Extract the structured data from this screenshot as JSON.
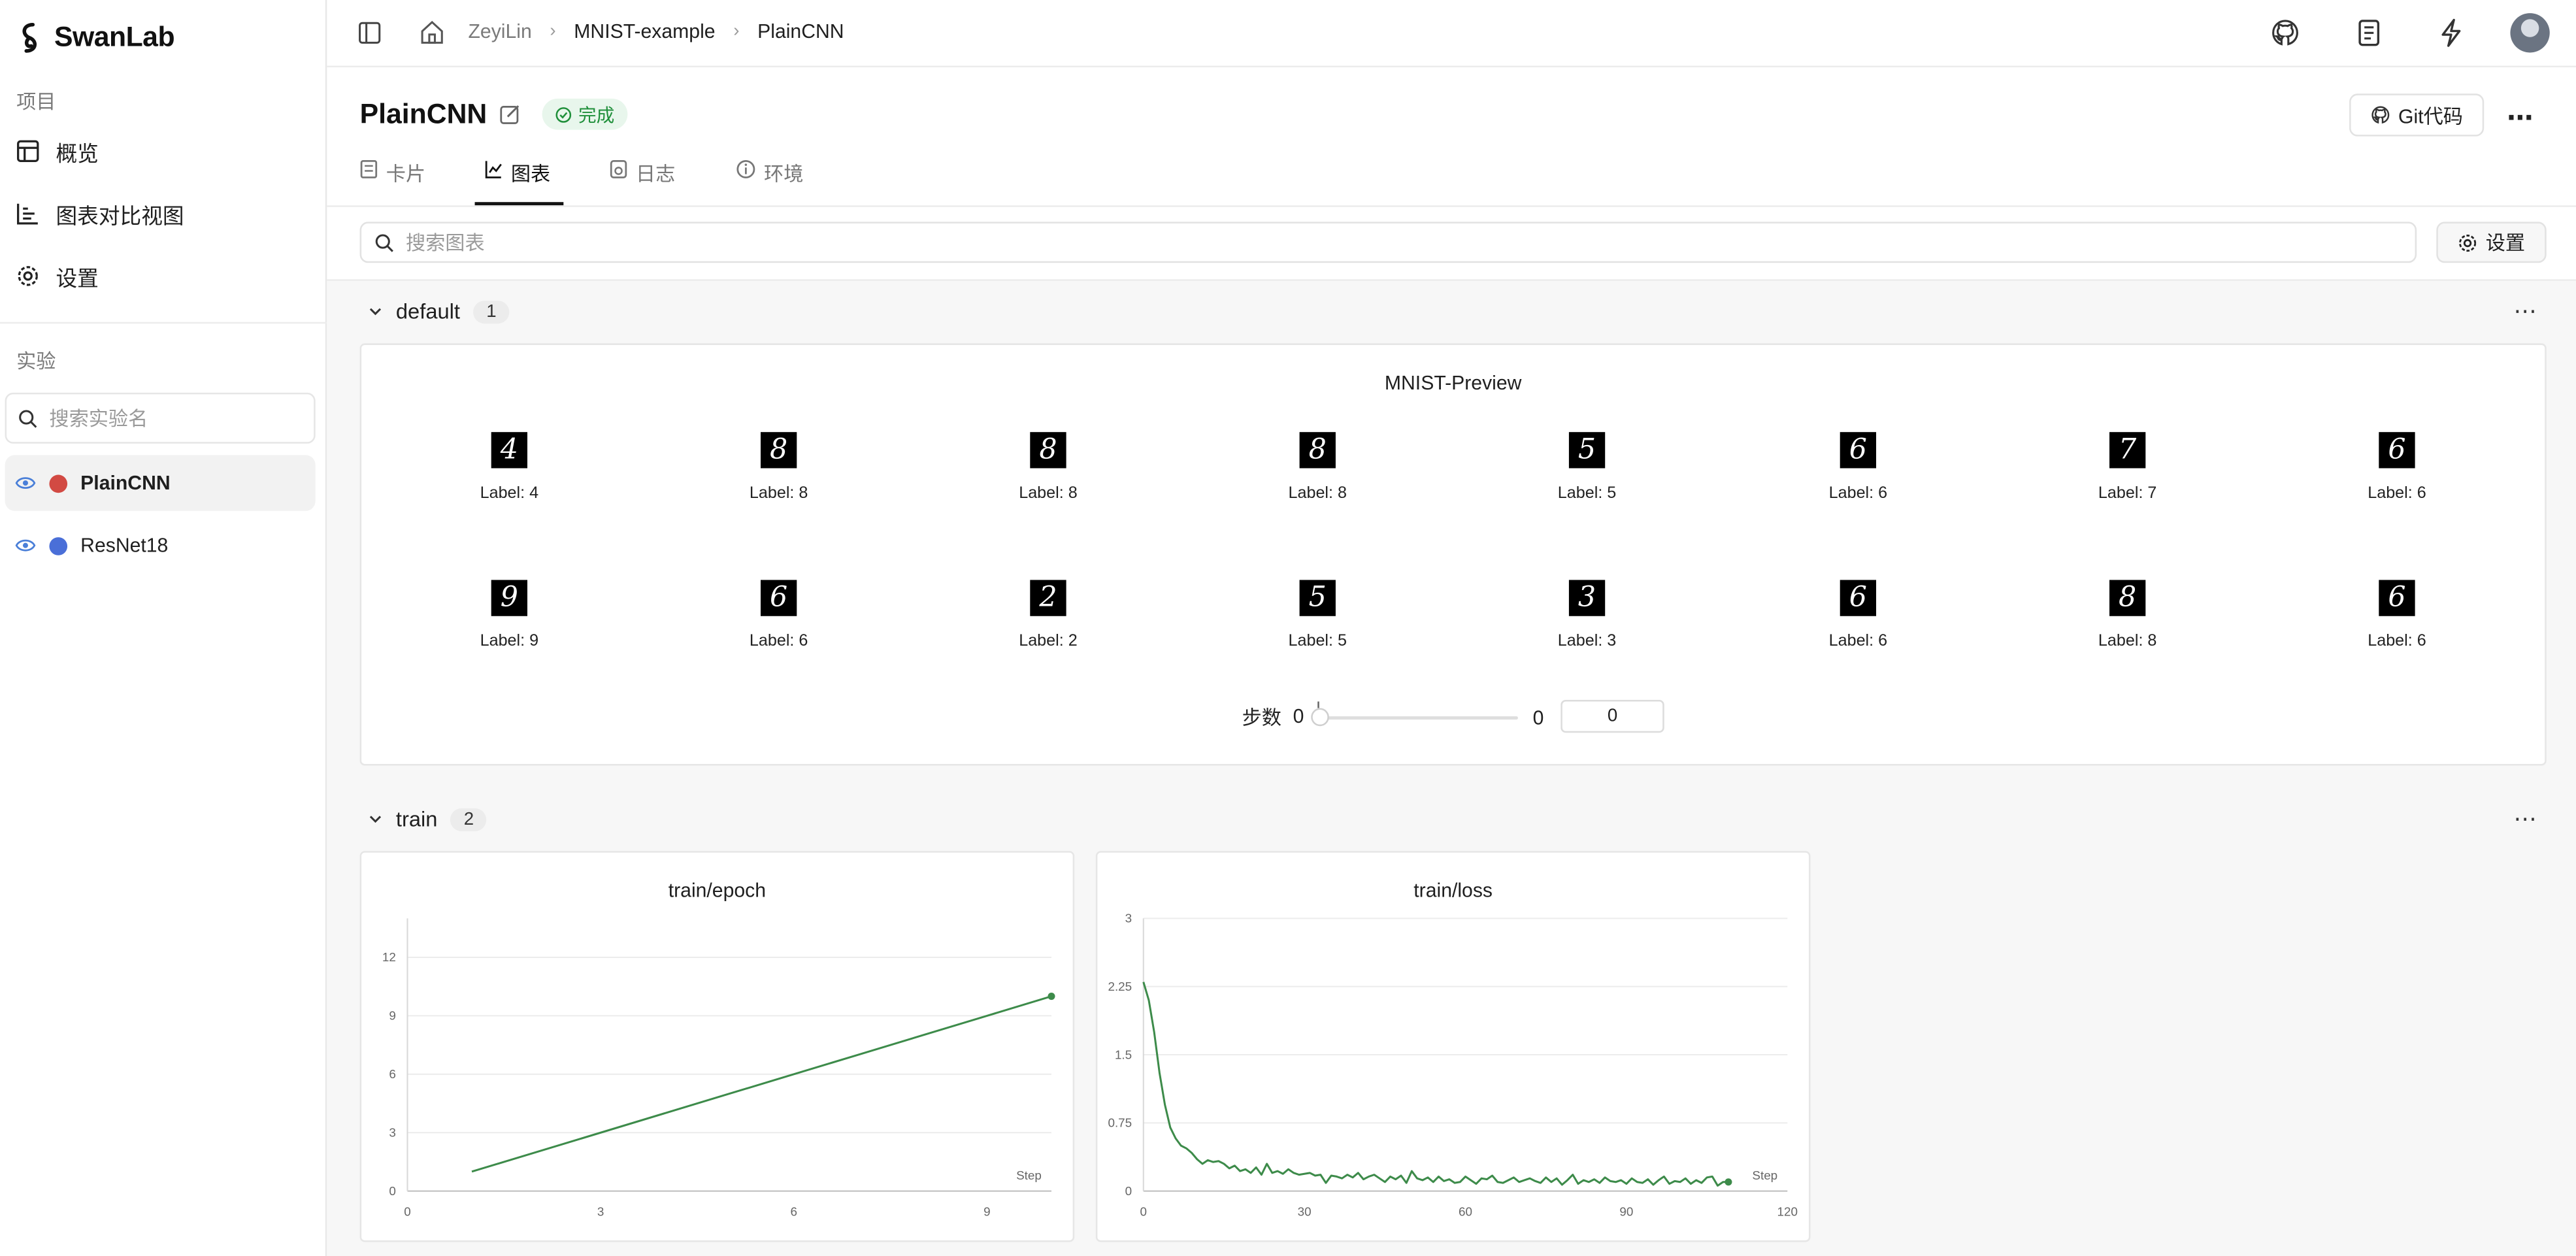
{
  "app": {
    "name": "SwanLab"
  },
  "sidebar": {
    "project_section": "项目",
    "nav": [
      {
        "label": "概览",
        "icon": "table-icon"
      },
      {
        "label": "图表对比视图",
        "icon": "bar-chart-icon"
      },
      {
        "label": "设置",
        "icon": "gear-icon"
      }
    ],
    "experiment_section": "实验",
    "search_placeholder": "搜索实验名",
    "experiments": [
      {
        "name": "PlainCNN",
        "color": "#d24a43",
        "active": true
      },
      {
        "name": "ResNet18",
        "color": "#4a6fd8",
        "active": false
      }
    ]
  },
  "topbar": {
    "breadcrumb": [
      "ZeyiLin",
      "MNIST-example",
      "PlainCNN"
    ]
  },
  "header": {
    "title": "PlainCNN",
    "status": "完成",
    "git_label": "Git代码"
  },
  "tabs": [
    {
      "label": "卡片",
      "icon": "card-icon"
    },
    {
      "label": "图表",
      "icon": "line-chart-icon",
      "active": true
    },
    {
      "label": "日志",
      "icon": "log-icon"
    },
    {
      "label": "环境",
      "icon": "info-icon"
    }
  ],
  "toolbar": {
    "search_placeholder": "搜索图表",
    "settings_label": "设置"
  },
  "groups": {
    "default": {
      "name": "default",
      "count": "1",
      "card_title": "MNIST-Preview",
      "images": [
        {
          "digit": "4",
          "label": "Label: 4"
        },
        {
          "digit": "8",
          "label": "Label: 8"
        },
        {
          "digit": "8",
          "label": "Label: 8"
        },
        {
          "digit": "8",
          "label": "Label: 8"
        },
        {
          "digit": "5",
          "label": "Label: 5"
        },
        {
          "digit": "6",
          "label": "Label: 6"
        },
        {
          "digit": "7",
          "label": "Label: 7"
        },
        {
          "digit": "6",
          "label": "Label: 6"
        },
        {
          "digit": "9",
          "label": "Label: 9"
        },
        {
          "digit": "6",
          "label": "Label: 6"
        },
        {
          "digit": "2",
          "label": "Label: 2"
        },
        {
          "digit": "5",
          "label": "Label: 5"
        },
        {
          "digit": "3",
          "label": "Label: 3"
        },
        {
          "digit": "6",
          "label": "Label: 6"
        },
        {
          "digit": "8",
          "label": "Label: 8"
        },
        {
          "digit": "6",
          "label": "Label: 6"
        }
      ],
      "step_label": "步数",
      "step_min": "0",
      "step_max": "0",
      "step_value": "0"
    },
    "train": {
      "name": "train",
      "count": "2"
    }
  },
  "chart_data": [
    {
      "type": "line",
      "title": "train/epoch",
      "xlabel": "Step",
      "ylabel": "",
      "xlim": [
        0,
        10
      ],
      "ylim": [
        0,
        14
      ],
      "xticks": [
        0,
        3,
        6,
        9
      ],
      "yticks": [
        0,
        3,
        6,
        9,
        12
      ],
      "grid": true,
      "color": "#3d8b4a",
      "x": [
        1,
        2,
        3,
        4,
        5,
        6,
        7,
        8,
        9,
        10
      ],
      "y": [
        1,
        2,
        3,
        4,
        5,
        6,
        7,
        8,
        9,
        10
      ]
    },
    {
      "type": "line",
      "title": "train/loss",
      "xlabel": "Step",
      "ylabel": "",
      "xlim": [
        0,
        120
      ],
      "ylim": [
        0,
        3
      ],
      "xticks": [
        0,
        30,
        60,
        90,
        120
      ],
      "xtick_labels": [
        "0",
        "30",
        "60",
        "90",
        "120"
      ],
      "yticks": [
        0,
        0.75,
        1.5,
        2.25,
        3
      ],
      "ytick_labels": [
        "0",
        "0.75",
        "1.5",
        "2.25",
        "3"
      ],
      "grid": true,
      "color": "#3d8b4a",
      "x": [
        0,
        1,
        2,
        3,
        4,
        5,
        6,
        7,
        8,
        9,
        10,
        11,
        12,
        13,
        14,
        15,
        16,
        17,
        18,
        19,
        20,
        21,
        22,
        23,
        24,
        25,
        26,
        27,
        28,
        29,
        30,
        31,
        32,
        33,
        34,
        35,
        36,
        37,
        38,
        39,
        40,
        41,
        42,
        43,
        44,
        45,
        46,
        47,
        48,
        49,
        50,
        51,
        52,
        53,
        54,
        55,
        56,
        57,
        58,
        59,
        60,
        61,
        62,
        63,
        64,
        65,
        66,
        67,
        68,
        69,
        70,
        71,
        72,
        73,
        74,
        75,
        76,
        77,
        78,
        79,
        80,
        81,
        82,
        83,
        84,
        85,
        86,
        87,
        88,
        89,
        90,
        91,
        92,
        93,
        94,
        95,
        96,
        97,
        98,
        99,
        100,
        101,
        102,
        103,
        104,
        105,
        106,
        107,
        108,
        109
      ],
      "y": [
        2.3,
        2.1,
        1.75,
        1.3,
        0.95,
        0.7,
        0.58,
        0.5,
        0.47,
        0.42,
        0.35,
        0.3,
        0.34,
        0.32,
        0.33,
        0.3,
        0.25,
        0.28,
        0.22,
        0.24,
        0.2,
        0.26,
        0.18,
        0.3,
        0.2,
        0.22,
        0.19,
        0.24,
        0.2,
        0.18,
        0.19,
        0.2,
        0.17,
        0.18,
        0.09,
        0.17,
        0.16,
        0.14,
        0.18,
        0.15,
        0.2,
        0.13,
        0.16,
        0.18,
        0.14,
        0.1,
        0.16,
        0.13,
        0.17,
        0.09,
        0.22,
        0.14,
        0.12,
        0.15,
        0.1,
        0.16,
        0.11,
        0.13,
        0.09,
        0.1,
        0.16,
        0.12,
        0.08,
        0.14,
        0.13,
        0.17,
        0.1,
        0.09,
        0.12,
        0.15,
        0.1,
        0.12,
        0.14,
        0.11,
        0.09,
        0.15,
        0.1,
        0.14,
        0.07,
        0.12,
        0.18,
        0.08,
        0.12,
        0.1,
        0.13,
        0.09,
        0.15,
        0.11,
        0.1,
        0.12,
        0.08,
        0.14,
        0.1,
        0.09,
        0.13,
        0.07,
        0.12,
        0.16,
        0.08,
        0.11,
        0.1,
        0.14,
        0.08,
        0.12,
        0.09,
        0.15,
        0.16,
        0.06,
        0.1,
        0.1
      ]
    }
  ]
}
